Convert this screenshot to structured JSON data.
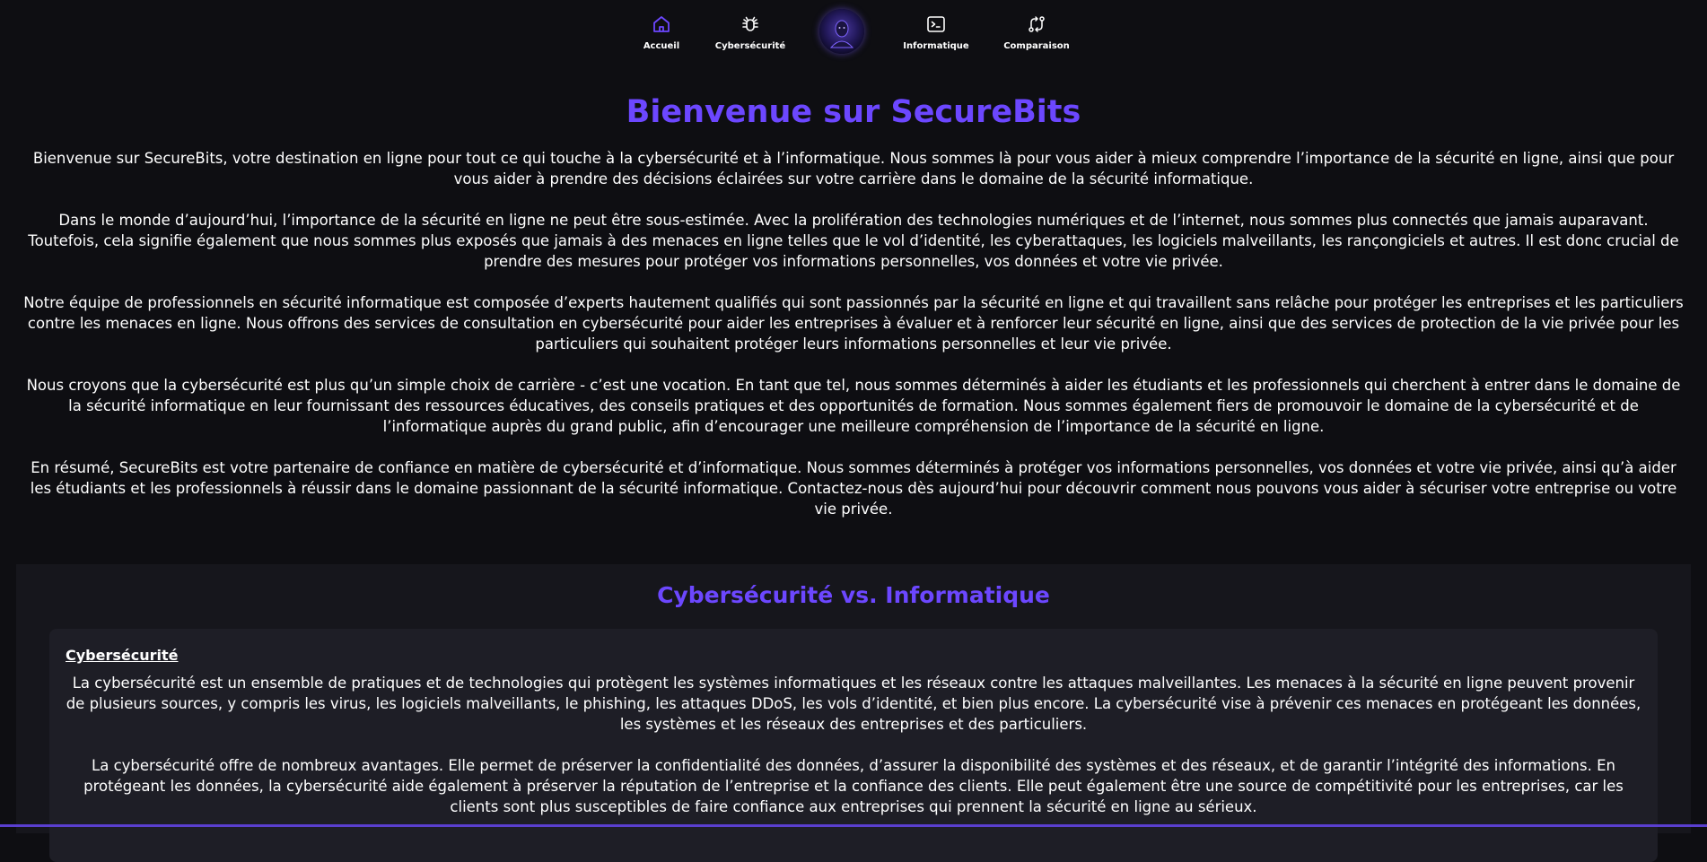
{
  "nav": {
    "home_label": "Accueil",
    "cyber_label": "Cybersécurité",
    "info_label": "Informatique",
    "compare_label": "Comparaison"
  },
  "colors": {
    "accent": "#6c47ff",
    "background": "#0e0e12",
    "section_bg": "#16161c",
    "card_bg": "#1e1e26"
  },
  "hero": {
    "title": "Bienvenue sur SecureBits",
    "paragraphs": [
      "Bienvenue sur SecureBits, votre destination en ligne pour tout ce qui touche à la cybersécurité et à l’informatique. Nous sommes là pour vous aider à mieux comprendre l’importance de la sécurité en ligne, ainsi que pour vous aider à prendre des décisions éclairées sur votre carrière dans le domaine de la sécurité informatique.",
      "Dans le monde d’aujourd’hui, l’importance de la sécurité en ligne ne peut être sous-estimée. Avec la prolifération des technologies numériques et de l’internet, nous sommes plus connectés que jamais auparavant. Toutefois, cela signifie également que nous sommes plus exposés que jamais à des menaces en ligne telles que le vol d’identité, les cyberattaques, les logiciels malveillants, les rançongiciels et autres. Il est donc crucial de prendre des mesures pour protéger vos informations personnelles, vos données et votre vie privée.",
      "Notre équipe de professionnels en sécurité informatique est composée d’experts hautement qualifiés qui sont passionnés par la sécurité en ligne et qui travaillent sans relâche pour protéger les entreprises et les particuliers contre les menaces en ligne. Nous offrons des services de consultation en cybersécurité pour aider les entreprises à évaluer et à renforcer leur sécurité en ligne, ainsi que des services de protection de la vie privée pour les particuliers qui souhaitent protéger leurs informations personnelles et leur vie privée.",
      "Nous croyons que la cybersécurité est plus qu’un simple choix de carrière - c’est une vocation. En tant que tel, nous sommes déterminés à aider les étudiants et les professionnels qui cherchent à entrer dans le domaine de la sécurité informatique en leur fournissant des ressources éducatives, des conseils pratiques et des opportunités de formation. Nous sommes également fiers de promouvoir le domaine de la cybersécurité et de l’informatique auprès du grand public, afin d’encourager une meilleure compréhension de l’importance de la sécurité en ligne.",
      "En résumé, SecureBits est votre partenaire de confiance en matière de cybersécurité et d’informatique. Nous sommes déterminés à protéger vos informations personnelles, vos données et votre vie privée, ainsi qu’à aider les étudiants et les professionnels à réussir dans le domaine passionnant de la sécurité informatique. Contactez-nous dès aujourd’hui pour découvrir comment nous pouvons vous aider à sécuriser votre entreprise ou votre vie privée."
    ]
  },
  "comparison": {
    "title": "Cybersécurité vs. Informatique",
    "card": {
      "heading": "Cybersécurité",
      "paragraphs": [
        "La cybersécurité est un ensemble de pratiques et de technologies qui protègent les systèmes informatiques et les réseaux contre les attaques malveillantes. Les menaces à la sécurité en ligne peuvent provenir de plusieurs sources, y compris les virus, les logiciels malveillants, le phishing, les attaques DDoS, les vols d’identité, et bien plus encore. La cybersécurité vise à prévenir ces menaces en protégeant les données, les systèmes et les réseaux des entreprises et des particuliers.",
        "La cybersécurité offre de nombreux avantages. Elle permet de préserver la confidentialité des données, d’assurer la disponibilité des systèmes et des réseaux, et de garantir l’intégrité des informations. En protégeant les données, la cybersécurité aide également à préserver la réputation de l’entreprise et la confiance des clients. Elle peut également être une source de compétitivité pour les entreprises, car les clients sont plus susceptibles de faire confiance aux entreprises qui prennent la sécurité en ligne au sérieux."
      ]
    }
  }
}
